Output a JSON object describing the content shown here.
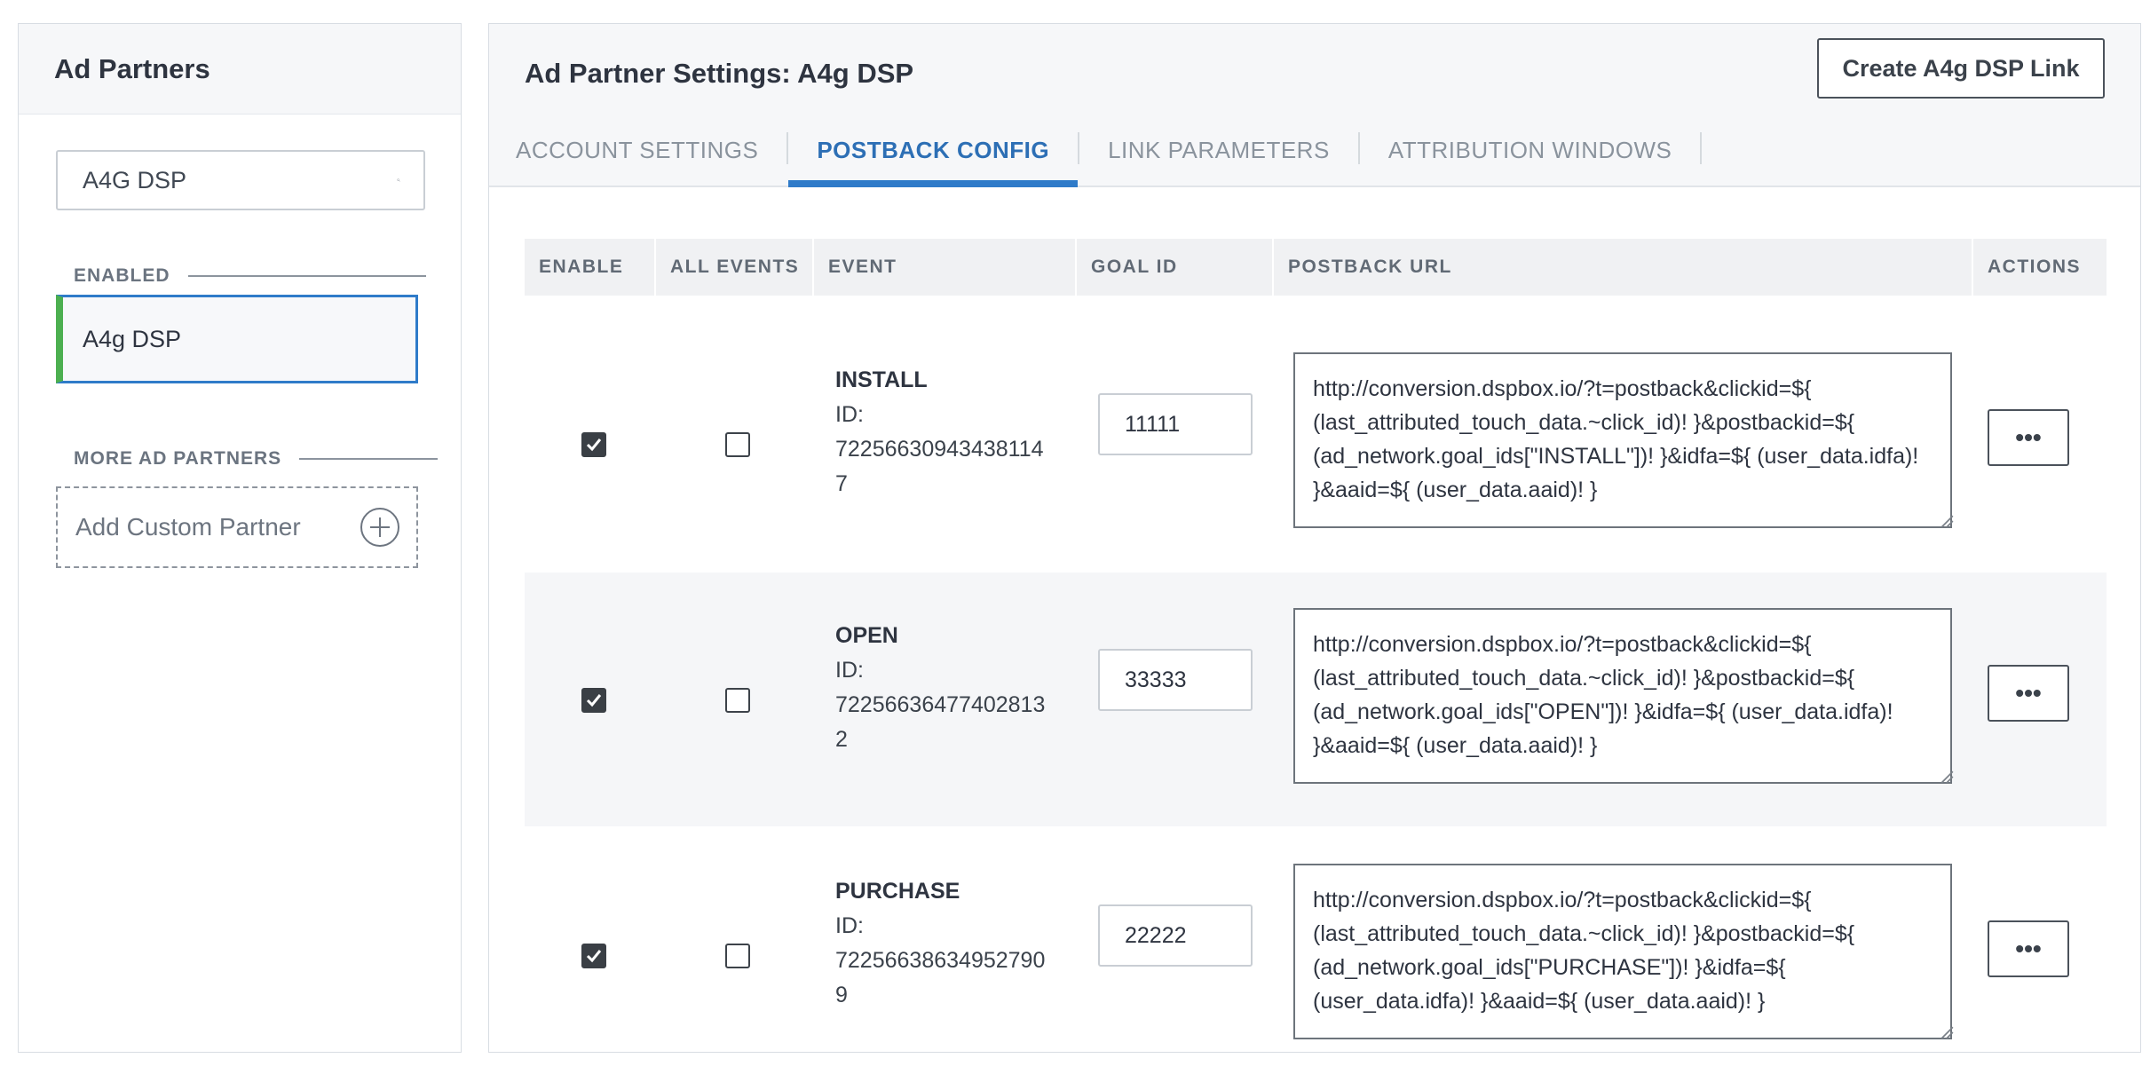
{
  "sidebar": {
    "title": "Ad Partners",
    "search": {
      "value": "A4G DSP",
      "placeholder": ""
    },
    "enabled_label": "ENABLED",
    "enabled_partners": [
      {
        "label": "A4g DSP"
      }
    ],
    "more_label": "MORE AD PARTNERS",
    "add_custom_label": "Add Custom Partner"
  },
  "main": {
    "title": "Ad Partner Settings: A4g DSP",
    "create_link_label": "Create A4g DSP Link",
    "tabs": [
      {
        "label": "ACCOUNT SETTINGS",
        "active": false
      },
      {
        "label": "POSTBACK CONFIG",
        "active": true
      },
      {
        "label": "LINK PARAMETERS",
        "active": false
      },
      {
        "label": "ATTRIBUTION WINDOWS",
        "active": false
      }
    ],
    "table": {
      "columns": [
        "ENABLE",
        "ALL EVENTS",
        "EVENT",
        "GOAL ID",
        "POSTBACK URL",
        "ACTIONS"
      ],
      "rows": [
        {
          "enabled": true,
          "all_events": false,
          "event": "INSTALL",
          "id_label": "ID:",
          "id_line1": "72256630943438114",
          "id_line2": "7",
          "goal_id": "11111",
          "postback_url": "http://conversion.dspbox.io/?t=postback&clickid=${ (last_attributed_touch_data.~click_id)! }&postbackid=${ (ad_network.goal_ids[\"INSTALL\"])! }&idfa=${ (user_data.idfa)! }&aaid=${ (user_data.aaid)! }",
          "actions_label": "•••"
        },
        {
          "enabled": true,
          "all_events": false,
          "event": "OPEN",
          "id_label": "ID:",
          "id_line1": "72256636477402813",
          "id_line2": "2",
          "goal_id": "33333",
          "postback_url": "http://conversion.dspbox.io/?t=postback&clickid=${ (last_attributed_touch_data.~click_id)! }&postbackid=${ (ad_network.goal_ids[\"OPEN\"])! }&idfa=${ (user_data.idfa)! }&aaid=${ (user_data.aaid)! }",
          "actions_label": "•••"
        },
        {
          "enabled": true,
          "all_events": false,
          "event": "PURCHASE",
          "id_label": "ID:",
          "id_line1": "72256638634952790",
          "id_line2": "9",
          "goal_id": "22222",
          "postback_url": "http://conversion.dspbox.io/?t=postback&clickid=${ (last_attributed_touch_data.~click_id)! }&postbackid=${ (ad_network.goal_ids[\"PURCHASE\"])! }&idfa=${ (user_data.idfa)! }&aaid=${ (user_data.aaid)! }",
          "actions_label": "•••"
        }
      ]
    }
  },
  "colors": {
    "accent": "#2f7bc9",
    "enabled_bar": "#4caf50",
    "header_bg": "#f6f7f9"
  }
}
